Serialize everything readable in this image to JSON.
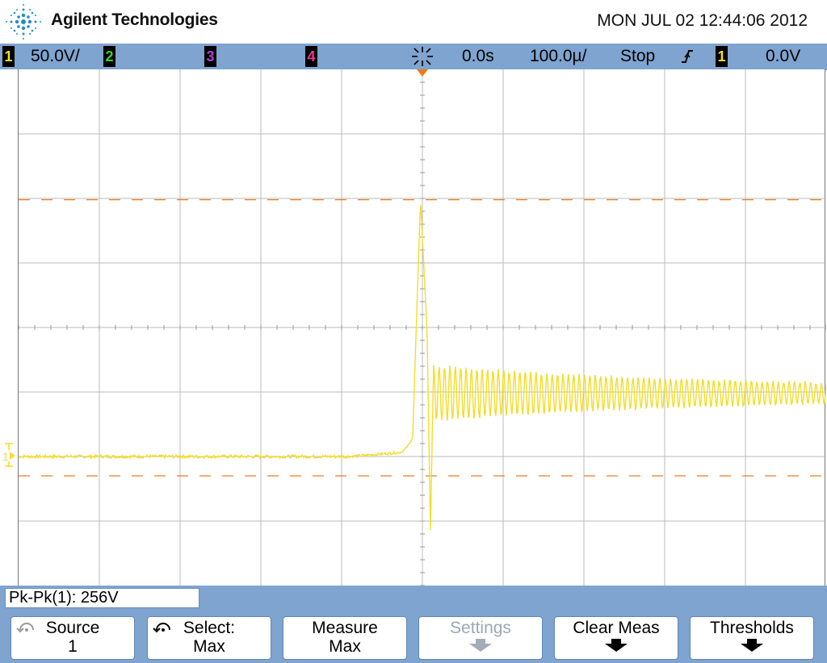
{
  "header": {
    "brand": "Agilent Technologies",
    "datetime": "MON JUL 02 12:44:06 2012",
    "logo_icon": "agilent-spark-icon"
  },
  "status": {
    "ch1_num": "1",
    "ch1_scale": "50.0V/",
    "ch2_num": "2",
    "ch3_num": "3",
    "ch4_num": "4",
    "time_delay": "0.0s",
    "time_scale": "100.0µ/",
    "run_state": "Stop",
    "trigger_slope_icon": "rising-edge-icon",
    "trigger_source": "1",
    "trigger_level": "0.0V",
    "colors": {
      "ch1": "#f3dd2b",
      "ch2": "#37d337",
      "ch3": "#b23fd4",
      "ch4": "#e8368c",
      "marker": "#f07a1a"
    }
  },
  "measurement": {
    "readout": "Pk-Pk(1): 256V"
  },
  "softkeys": {
    "source_title": "Source",
    "source_value": "1",
    "select_title": "Select:",
    "select_value": "Max",
    "measure_title": "Measure",
    "measure_value": "Max",
    "settings_title": "Settings",
    "clear_title": "Clear Meas",
    "thresholds_title": "Thresholds"
  },
  "trace": {
    "ch1_scale_v_per_div": 50,
    "time_per_div_us": 100,
    "baseline_v": 0,
    "overshoot_peak_v": 199,
    "undershoot_v": -57,
    "settled_v": 49,
    "ring_frequency_khz": 150,
    "ring_amplitude_v": 18,
    "ring_decay_tau_us": 330
  }
}
